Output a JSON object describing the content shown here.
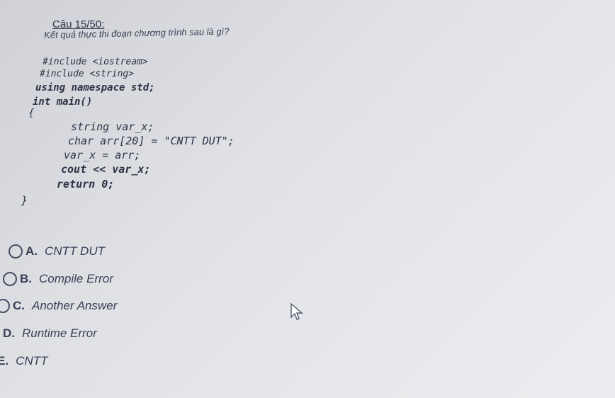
{
  "question": {
    "title": "Câu 15/50:",
    "text": "Kết quả thực thi đoạn chương trình sau là gì?"
  },
  "code": {
    "lines": [
      "#include <iostream>",
      "#include <string>",
      "using namespace std;",
      "int main()",
      "{",
      "string var_x;",
      "char arr[20] = \"CNTT DUT\";",
      "var_x = arr;",
      "cout << var_x;",
      "return 0;",
      "}"
    ]
  },
  "options": [
    {
      "letter": "A.",
      "text": "CNTT DUT"
    },
    {
      "letter": "B.",
      "text": "Compile Error"
    },
    {
      "letter": "C.",
      "text": "Another Answer"
    },
    {
      "letter": "D.",
      "text": "Runtime Error"
    },
    {
      "letter": "E.",
      "text": "CNTT"
    }
  ],
  "icons": {
    "cursor": "mouse-pointer-icon",
    "radio": "radio-circle-icon"
  }
}
